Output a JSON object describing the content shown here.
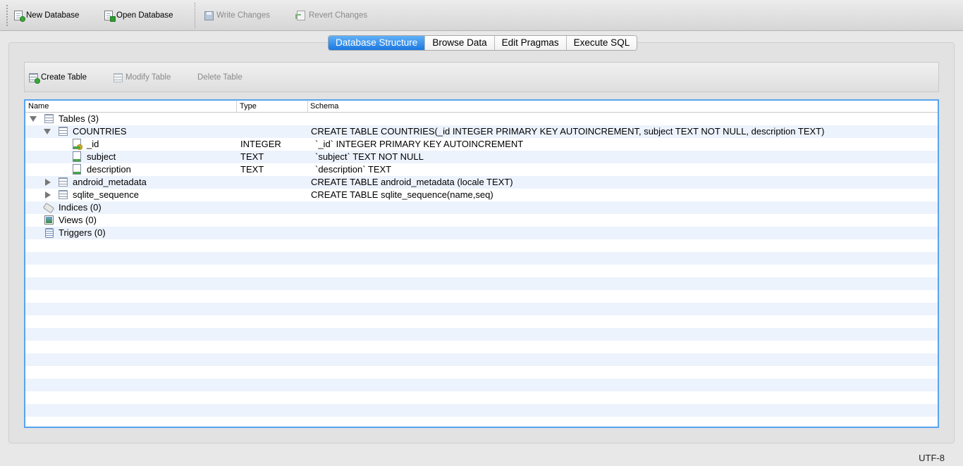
{
  "toolbar": {
    "new_database": "New Database",
    "open_database": "Open Database",
    "write_changes": "Write Changes",
    "revert_changes": "Revert Changes"
  },
  "tabs": [
    {
      "label": "Database Structure",
      "active": true
    },
    {
      "label": "Browse Data",
      "active": false
    },
    {
      "label": "Edit Pragmas",
      "active": false
    },
    {
      "label": "Execute SQL",
      "active": false
    }
  ],
  "structure_toolbar": {
    "create_table": "Create Table",
    "modify_table": "Modify Table",
    "delete_table": "Delete Table"
  },
  "tree": {
    "columns": [
      "Name",
      "Type",
      "Schema"
    ],
    "rows": [
      {
        "name": "Tables (3)",
        "type": "",
        "schema": "",
        "icon": "table-icon",
        "expander": "expanded"
      },
      {
        "name": "COUNTRIES",
        "type": "",
        "schema": "CREATE TABLE COUNTRIES(_id INTEGER PRIMARY KEY AUTOINCREMENT, subject TEXT NOT NULL, description TEXT)",
        "icon": "table-icon",
        "expander": "expanded"
      },
      {
        "name": "_id",
        "type": "INTEGER",
        "schema": "`_id` INTEGER PRIMARY KEY AUTOINCREMENT",
        "icon": "primary-key-field-icon",
        "expander": "none"
      },
      {
        "name": "subject",
        "type": "TEXT",
        "schema": "`subject` TEXT NOT NULL",
        "icon": "field-icon",
        "expander": "none"
      },
      {
        "name": "description",
        "type": "TEXT",
        "schema": "`description` TEXT",
        "icon": "field-icon",
        "expander": "none"
      },
      {
        "name": "android_metadata",
        "type": "",
        "schema": "CREATE TABLE android_metadata (locale TEXT)",
        "icon": "table-icon",
        "expander": "collapsed"
      },
      {
        "name": "sqlite_sequence",
        "type": "",
        "schema": "CREATE TABLE sqlite_sequence(name,seq)",
        "icon": "table-icon",
        "expander": "collapsed"
      },
      {
        "name": "Indices (0)",
        "type": "",
        "schema": "",
        "icon": "index-tag-icon",
        "expander": "none"
      },
      {
        "name": "Views (0)",
        "type": "",
        "schema": "",
        "icon": "view-icon",
        "expander": "none"
      },
      {
        "name": "Triggers (0)",
        "type": "",
        "schema": "",
        "icon": "trigger-icon",
        "expander": "none"
      }
    ]
  },
  "status_bar": {
    "encoding": "UTF-8"
  },
  "colors": {
    "active_tab": "#1a78e0",
    "tree_focus_border": "#58a4f0",
    "alt_row": "#edf3fd"
  }
}
